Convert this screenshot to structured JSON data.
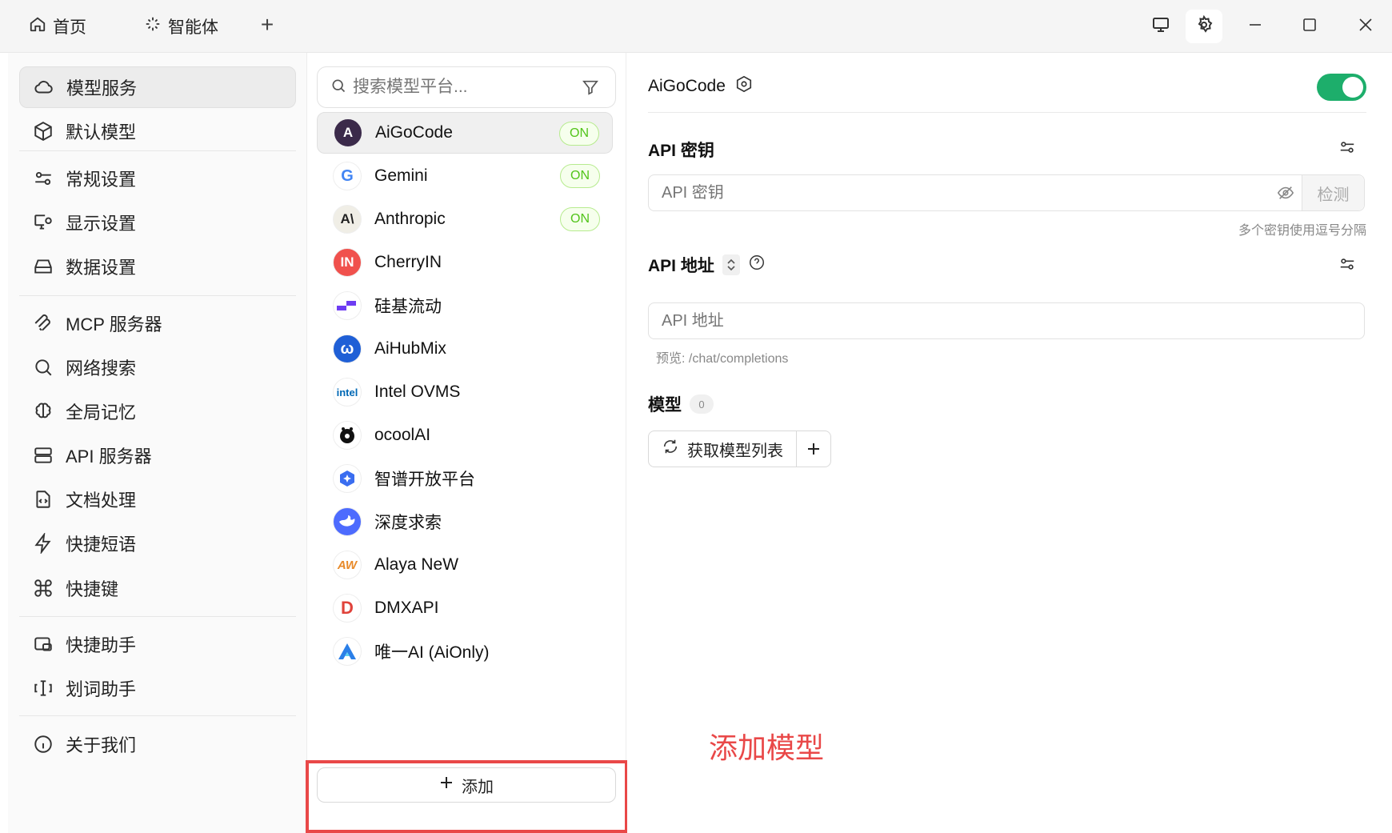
{
  "titlebar": {
    "home_label": "首页",
    "agent_label": "智能体",
    "new_tab": "+"
  },
  "sidebar": {
    "items": [
      {
        "label": "模型服务",
        "icon": "cloud-icon",
        "active": true
      },
      {
        "label": "默认模型",
        "icon": "cube-icon"
      },
      {
        "label": "常规设置",
        "icon": "sliders-icon"
      },
      {
        "label": "显示设置",
        "icon": "monitor-gear-icon"
      },
      {
        "label": "数据设置",
        "icon": "hard-drive-icon"
      },
      {
        "label": "MCP 服务器",
        "icon": "mcp-icon"
      },
      {
        "label": "网络搜索",
        "icon": "search-icon"
      },
      {
        "label": "全局记忆",
        "icon": "brain-icon"
      },
      {
        "label": "API 服务器",
        "icon": "server-icon"
      },
      {
        "label": "文档处理",
        "icon": "file-code-icon"
      },
      {
        "label": "快捷短语",
        "icon": "zap-icon"
      },
      {
        "label": "快捷键",
        "icon": "command-icon"
      },
      {
        "label": "快捷助手",
        "icon": "assistant-icon"
      },
      {
        "label": "划词助手",
        "icon": "text-cursor-icon"
      },
      {
        "label": "关于我们",
        "icon": "info-icon"
      }
    ]
  },
  "providers": {
    "search_placeholder": "搜索模型平台...",
    "on_label": "ON",
    "items": [
      {
        "name": "AiGoCode",
        "logo_text": "A",
        "logo_color": "#3b2a4a",
        "on": true
      },
      {
        "name": "Gemini",
        "logo_text": "G",
        "logo_color": "#ffffff",
        "on": true
      },
      {
        "name": "Anthropic",
        "logo_text": "A\\",
        "logo_color": "#f0eee6",
        "on": true
      },
      {
        "name": "CherryIN",
        "logo_text": "IN",
        "logo_color": "#f0514d"
      },
      {
        "name": "硅基流动",
        "logo_text": "",
        "logo_color": "#ffffff"
      },
      {
        "name": "AiHubMix",
        "logo_text": "ω",
        "logo_color": "#1f5fd6"
      },
      {
        "name": "Intel OVMS",
        "logo_text": "intel",
        "logo_color": "#ffffff"
      },
      {
        "name": "ocoolAI",
        "logo_text": "",
        "logo_color": "#ffffff"
      },
      {
        "name": "智谱开放平台",
        "logo_text": "",
        "logo_color": "#ffffff"
      },
      {
        "name": "深度求索",
        "logo_text": "",
        "logo_color": "#4d6bfe"
      },
      {
        "name": "Alaya NeW",
        "logo_text": "AW",
        "logo_color": "#ffffff"
      },
      {
        "name": "DMXAPI",
        "logo_text": "D",
        "logo_color": "#ffffff"
      },
      {
        "name": "唯一AI (AiOnly)",
        "logo_text": "",
        "logo_color": "#ffffff"
      }
    ],
    "add_label": "添加"
  },
  "detail": {
    "title": "AiGoCode",
    "enabled": true,
    "api_key_title": "API 密钥",
    "api_key_placeholder": "API 密钥",
    "check_label": "检测",
    "api_key_hint": "多个密钥使用逗号分隔",
    "api_url_title": "API 地址",
    "api_url_placeholder": "API 地址",
    "preview_label": "预览: /chat/completions",
    "models_title": "模型",
    "models_count": "0",
    "fetch_label": "获取模型列表"
  },
  "annotation": {
    "text": "添加模型",
    "color": "#e94848"
  },
  "colors": {
    "accent_green": "#1dae6b",
    "on_badge": "#52c41a"
  }
}
